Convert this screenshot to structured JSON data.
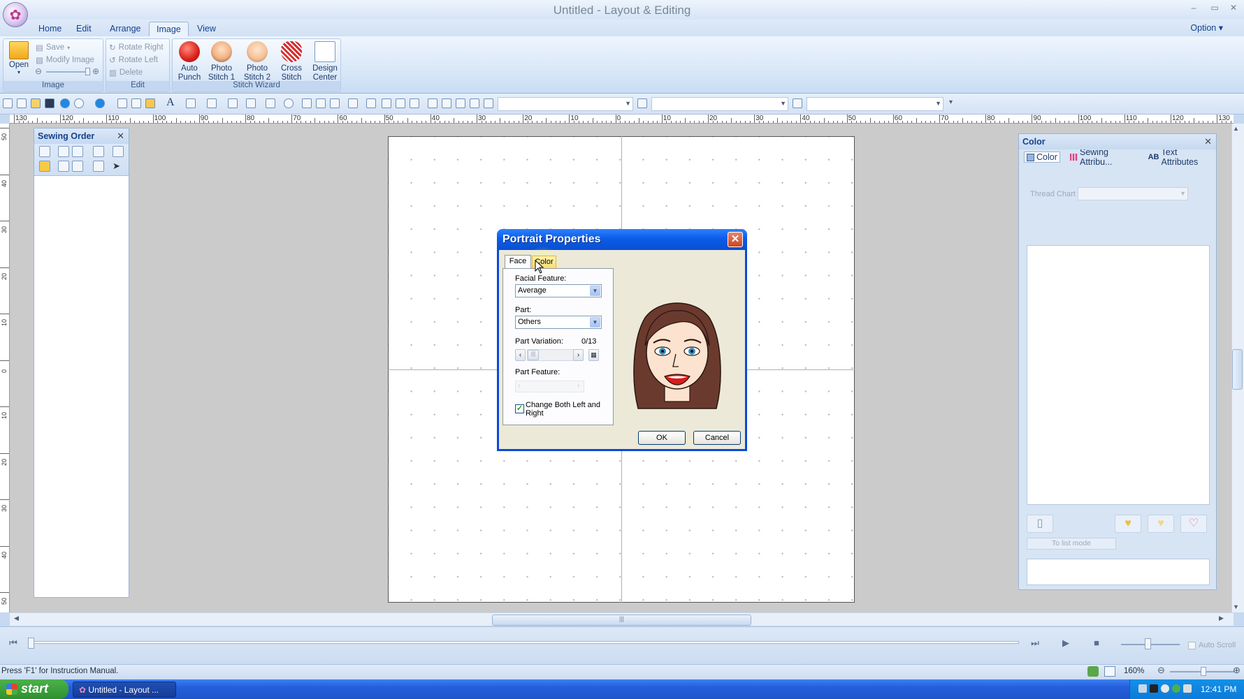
{
  "window": {
    "title": "Untitled - Layout & Editing",
    "minimize": "–",
    "restore": "▭",
    "close": "✕"
  },
  "menu": {
    "tabs": [
      "Home",
      "Edit",
      "Arrange",
      "Image",
      "View"
    ],
    "active": "Image",
    "option": "Option"
  },
  "ribbon": {
    "image_group": {
      "label": "Image",
      "open": "Open",
      "save": "Save",
      "modify_image": "Modify Image"
    },
    "edit_group": {
      "label": "Edit",
      "rotate_right": "Rotate Right",
      "rotate_left": "Rotate Left",
      "delete": "Delete"
    },
    "stitch_wizard_group": {
      "label": "Stitch Wizard",
      "auto_punch": "Auto Punch",
      "photo_stitch_1": "Photo Stitch 1",
      "photo_stitch_2": "Photo Stitch 2",
      "cross_stitch": "Cross Stitch"
    },
    "design_center": "Design Center"
  },
  "ruler": {
    "horizontal_labels": [
      "130",
      "120",
      "110",
      "100",
      "90",
      "80",
      "70",
      "60",
      "50",
      "40",
      "30",
      "20",
      "10",
      "0",
      "10",
      "20",
      "30",
      "40",
      "50",
      "60",
      "70",
      "80",
      "90",
      "100",
      "110",
      "120",
      "130"
    ],
    "vertical_labels": [
      "50",
      "40",
      "30",
      "20",
      "10",
      "0",
      "10",
      "20",
      "30",
      "40",
      "50"
    ]
  },
  "sewing_order": {
    "title": "Sewing Order",
    "close": "✕"
  },
  "color_panel": {
    "title": "Color",
    "close": "✕",
    "tabs": [
      "Color",
      "Sewing Attribu...",
      "Text Attributes"
    ],
    "tab_prefix": "AB",
    "thread_chart_label": "Thread Chart",
    "to_list_mode": "To list mode"
  },
  "dialog": {
    "title": "Portrait Properties",
    "close": "✕",
    "tabs": {
      "face": "Face",
      "color": "Color"
    },
    "facial_feature_label": "Facial Feature:",
    "facial_feature_value": "Average",
    "part_label": "Part:",
    "part_value": "Others",
    "part_variation_label": "Part Variation:",
    "part_variation_value": "0/13",
    "part_feature_label": "Part Feature:",
    "change_both_label": "Change Both Left and Right",
    "change_both_checked": true,
    "ok": "OK",
    "cancel": "Cancel"
  },
  "status": {
    "text": "Press 'F1' for Instruction Manual.",
    "zoom": "160%",
    "auto_scroll": "Auto Scroll"
  },
  "taskbar": {
    "start": "start",
    "task": "Untitled - Layout ...",
    "clock": "12:41 PM"
  },
  "colors": {
    "accent": "#15428b",
    "dialog_title": "#0a4fd1",
    "taskbar": "#245edb",
    "start": "#2f8f2f"
  }
}
